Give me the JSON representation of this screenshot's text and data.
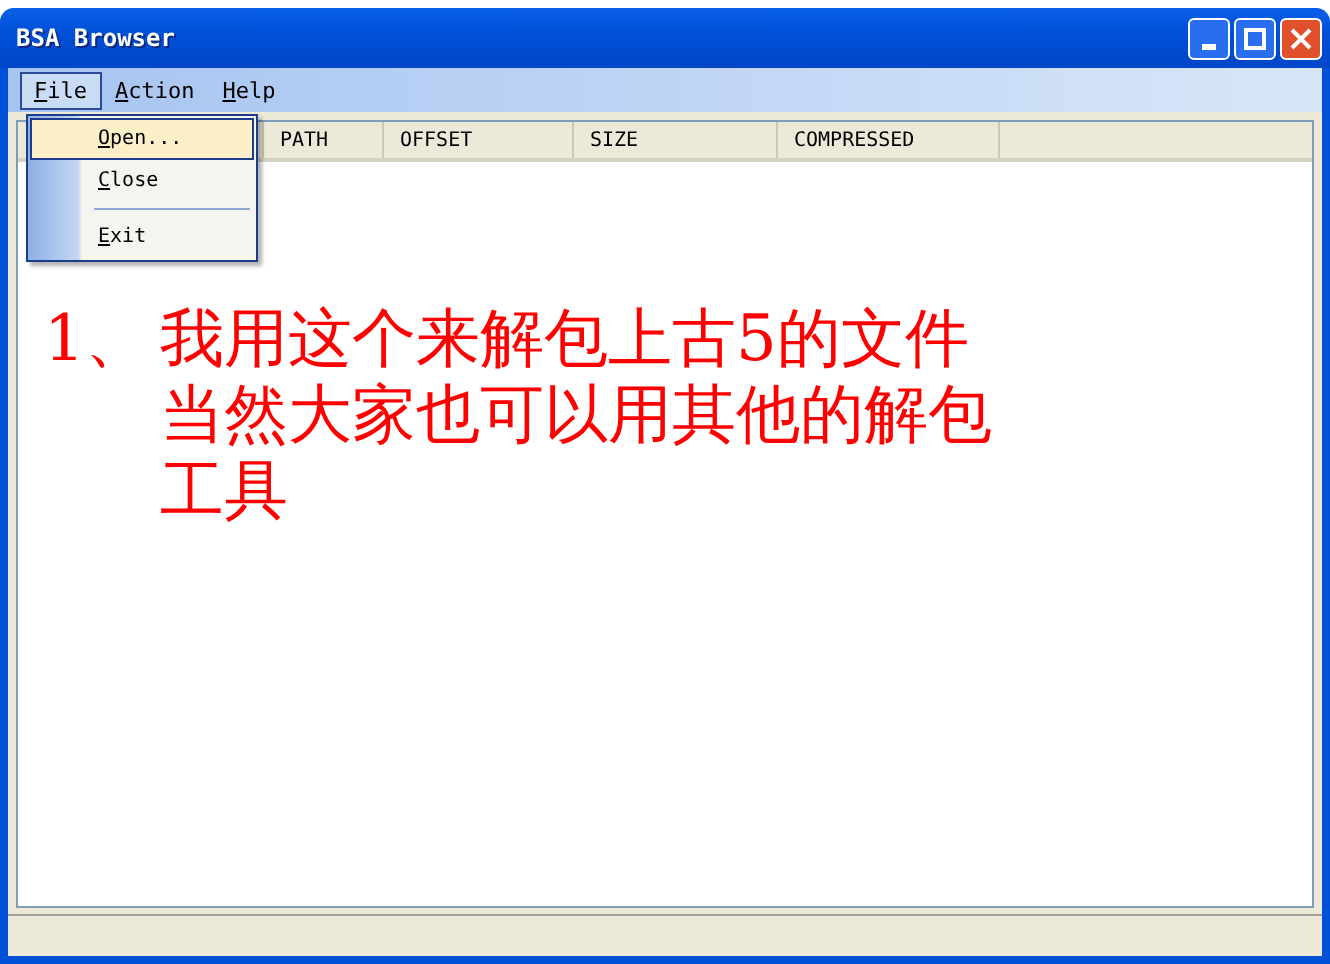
{
  "window": {
    "title": "BSA Browser"
  },
  "menu_bar": [
    {
      "label": "File",
      "selected": true
    },
    {
      "label": "Action",
      "selected": false
    },
    {
      "label": "Help",
      "selected": false
    }
  ],
  "file_menu": [
    {
      "kind": "item",
      "label": "Open...",
      "selected": true
    },
    {
      "kind": "item",
      "label": "Close",
      "selected": false
    },
    {
      "kind": "separator"
    },
    {
      "kind": "item",
      "label": "Exit",
      "selected": false
    }
  ],
  "table": {
    "columns": [
      "PATH",
      "OFFSET",
      "SIZE",
      "COMPRESSED"
    ]
  },
  "annotation": {
    "number": "1、",
    "lines": [
      "我用这个来解包上古5的文件",
      "当然大家也可以用其他的解包",
      "工具"
    ]
  }
}
